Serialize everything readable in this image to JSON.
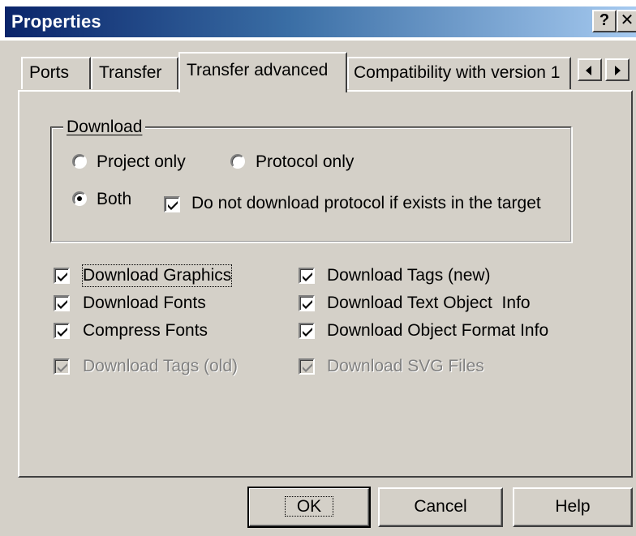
{
  "window": {
    "title": "Properties",
    "help_glyph": "?",
    "close_glyph": "✕"
  },
  "tabs": [
    {
      "label": "Ports"
    },
    {
      "label": "Transfer"
    },
    {
      "label": "Transfer advanced",
      "active": true
    },
    {
      "label": "Compatibility with version 1"
    }
  ],
  "download_group": {
    "legend": "Download",
    "radios": [
      {
        "label": "Project only",
        "checked": false
      },
      {
        "label": "Protocol only",
        "checked": false
      },
      {
        "label": "Both",
        "checked": true
      }
    ],
    "skip_protocol": {
      "label": "Do not download protocol if exists in the target",
      "checked": true
    }
  },
  "options": [
    {
      "label": "Download Graphics",
      "checked": true,
      "enabled": true
    },
    {
      "label": "Download Fonts",
      "checked": true,
      "enabled": true
    },
    {
      "label": "Compress Fonts",
      "checked": true,
      "enabled": true
    },
    {
      "label": "Download Tags (old)",
      "checked": true,
      "enabled": false
    },
    {
      "label": "Download Tags (new)",
      "checked": true,
      "enabled": true
    },
    {
      "label": "Download Text Object  Info",
      "checked": true,
      "enabled": true
    },
    {
      "label": "Download Object Format Info",
      "checked": true,
      "enabled": true
    },
    {
      "label": "Download SVG Files",
      "checked": true,
      "enabled": false
    }
  ],
  "buttons": {
    "ok": "OK",
    "cancel": "Cancel",
    "help": "Help"
  },
  "colors": {
    "face": "#d4d0c8",
    "title_start": "#0a246a",
    "title_end": "#a6caf0"
  },
  "icons": [
    "help-icon",
    "close-icon",
    "tab-scroll-left-icon",
    "tab-scroll-right-icon",
    "checkmark-icon"
  ]
}
